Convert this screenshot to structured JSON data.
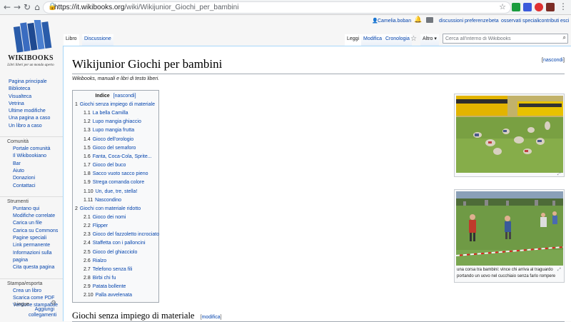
{
  "browser": {
    "url_host": "https://it.wikibooks.org",
    "url_path": "/wiki/Wikijunior_Giochi_per_bambini"
  },
  "logo": {
    "name": "WIKIBOOKS",
    "tagline": "Libri liberi per un mondo aperto"
  },
  "sidebar": {
    "main": [
      "Pagina principale",
      "Biblioteca",
      "Visualteca",
      "Vetrina",
      "Ultime modifiche",
      "Una pagina a caso",
      "Un libro a caso"
    ],
    "comunita": {
      "heading": "Comunità",
      "items": [
        "Portale comunità",
        "Il Wikibookiano",
        "Bar",
        "Aiuto",
        "Donazioni",
        "Contattaci"
      ]
    },
    "strumenti": {
      "heading": "Strumenti",
      "items": [
        "Puntano qui",
        "Modifiche correlate",
        "Carica un file",
        "Carica su Commons",
        "Pagine speciali",
        "Link permanente",
        "Informazioni sulla",
        "pagina",
        "Cita questa pagina"
      ]
    },
    "stampa": {
      "heading": "Stampa/esporta",
      "items": [
        "Crea un libro",
        "Scarica come PDF",
        "Versione stampabile"
      ]
    },
    "lingue": {
      "heading": "Lingue",
      "add_line1": "Aggiungi",
      "add_line2": "collegamenti"
    }
  },
  "personal": {
    "user": "Camelia.boban",
    "discussioni": "discussioni",
    "preferenze": "preferenze",
    "beta": "beta",
    "osservati": "osservati speciali",
    "contributi": "contributi",
    "esci": "esci"
  },
  "tabs": {
    "libro": "Libro",
    "discussione": "Discussione",
    "leggi": "Leggi",
    "modifica": "Modifica",
    "cronologia": "Cronologia",
    "altro": "Altro ▾"
  },
  "search": {
    "placeholder": "Cerca all'interno di Wikibooks"
  },
  "page": {
    "title": "Wikijunior Giochi per bambini",
    "nascondi": "nascondi",
    "subtitle": "Wikibooks, manuali e libri di testo liberi."
  },
  "toc": {
    "title": "Indice",
    "toggle": "[nascondi]",
    "entries": [
      {
        "num": "1",
        "label": "Giochi senza impiego di materiale",
        "level": 1
      },
      {
        "num": "1.1",
        "label": "La bella Camilla",
        "level": 2
      },
      {
        "num": "1.2",
        "label": "Lupo mangia ghiaccio",
        "level": 2
      },
      {
        "num": "1.3",
        "label": "Lupo mangia frutta",
        "level": 2
      },
      {
        "num": "1.4",
        "label": "Gioco dell'orologio",
        "level": 2
      },
      {
        "num": "1.5",
        "label": "Gioco del semaforo",
        "level": 2
      },
      {
        "num": "1.6",
        "label": "Fanta, Coca-Cola, Sprite...",
        "level": 2
      },
      {
        "num": "1.7",
        "label": "Gioco del buco",
        "level": 2
      },
      {
        "num": "1.8",
        "label": "Sacco vuoto sacco pieno",
        "level": 2
      },
      {
        "num": "1.9",
        "label": "Strega comanda colore",
        "level": 2
      },
      {
        "num": "1.10",
        "label": "Un, due, tre, stella!",
        "level": 2
      },
      {
        "num": "1.11",
        "label": "Nascondino",
        "level": 2
      },
      {
        "num": "2",
        "label": "Giochi con materiale ridotto",
        "level": 1
      },
      {
        "num": "2.1",
        "label": "Gioco dei nomi",
        "level": 2
      },
      {
        "num": "2.2",
        "label": "Flipper",
        "level": 2
      },
      {
        "num": "2.3",
        "label": "Gioco del fazzoletto incrociato",
        "level": 2
      },
      {
        "num": "2.4",
        "label": "Staffetta con i palloncini",
        "level": 2
      },
      {
        "num": "2.5",
        "label": "Gioco del ghiacciolo",
        "level": 2
      },
      {
        "num": "2.6",
        "label": "Rialzo",
        "level": 2
      },
      {
        "num": "2.7",
        "label": "Telefono senza fili",
        "level": 2
      },
      {
        "num": "2.8",
        "label": "Birbi chi fu",
        "level": 2
      },
      {
        "num": "2.9",
        "label": "Patata bollente",
        "level": 2
      },
      {
        "num": "2.10",
        "label": "Palla avvelenata",
        "level": 2
      }
    ]
  },
  "images": {
    "caption_line1": "una corsa tra bambini: vince chi arriva al traguardo",
    "caption_line2": "portando un uovo nel cucchiaio senza farlo rompere"
  },
  "section": {
    "heading": "Giochi senza impiego di materiale",
    "edit_open": "[",
    "edit_label": "modifica",
    "edit_close": "]"
  },
  "colors": {
    "link": "#0645ad",
    "content_border": "#a7d7f9",
    "sidebar_bg": "#f6f6f6"
  }
}
